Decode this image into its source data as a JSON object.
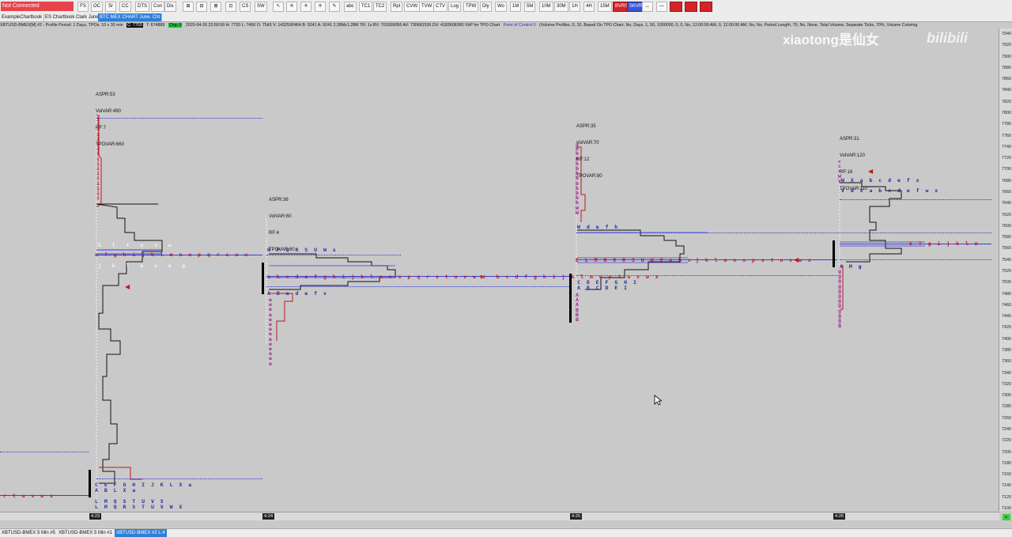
{
  "status": {
    "label": "Not Connected",
    "color": "#e8434b"
  },
  "toolbar": [
    {
      "label": "FS"
    },
    {
      "label": "OC"
    },
    {
      "label": "Sr"
    },
    {
      "label": "CC"
    },
    {
      "label": "DTS"
    },
    {
      "label": "Con"
    },
    {
      "label": "Dis"
    },
    {
      "label": "⊞"
    },
    {
      "label": "⊟"
    },
    {
      "label": "⊠"
    },
    {
      "label": "⊡"
    },
    {
      "label": "CS"
    },
    {
      "label": "SW"
    },
    {
      "label": "↖"
    },
    {
      "label": "✛"
    },
    {
      "label": "✛"
    },
    {
      "label": "✛"
    },
    {
      "label": "✎"
    },
    {
      "label": "abc"
    },
    {
      "label": "TC1"
    },
    {
      "label": "TC2"
    },
    {
      "label": "Rpl"
    },
    {
      "label": "CVW"
    },
    {
      "label": "TVW"
    },
    {
      "label": "CTV"
    },
    {
      "label": "Log"
    },
    {
      "label": "TPW"
    },
    {
      "label": "Dly"
    },
    {
      "label": "Wo"
    },
    {
      "label": "1M"
    },
    {
      "label": "5M"
    },
    {
      "label": "10M"
    },
    {
      "label": "30M"
    },
    {
      "label": "1H"
    },
    {
      "label": "4H"
    },
    {
      "label": "15M"
    },
    {
      "label": "BVRS",
      "style": "red"
    },
    {
      "label": "SKVR",
      "style": "blue"
    },
    {
      "label": "↔"
    },
    {
      "label": "—"
    },
    {
      "label": "",
      "style": "red"
    },
    {
      "label": "",
      "style": "red"
    },
    {
      "label": "",
      "style": "red"
    }
  ],
  "tabs": [
    {
      "label": "ExampleChartbook",
      "active": false
    },
    {
      "label": "ES Chartbook Clark June",
      "active": false
    },
    {
      "label": "BTC MEX CHART June. Cht",
      "active": true
    }
  ],
  "info_line": {
    "symbol": "XBTUSD-BMEX[M]  #2 - Profile Period: 1 Days, TPOs: 10 x 30 min",
    "c_value": "C: 7703",
    "t_value": "T: 674889",
    "chg_value": "Chg: 0",
    "stats": "2020-04-26 23:59:59  H: 7720  L: 7450  O: 7543  V: 1432590464  B: 9241  A: 9241  2.28Mx1.28M  TR: 1s  BV: 701909056  AV: 730681536  DV: 4183608360  VbP for TPO Chart",
    "poc": "Point of Control 0",
    "vp": "(Volume Profiles, 0, 10, Based On TPO Chart, No, Days, 1, 50, 1000000, 0, 0, No, 12:00:00 AM, 0, 12:00:00 AM, No, No, Period Length, 70, No, None, Total Volume, Separate Ticks, 70%, Volume Coloring"
  },
  "price_axis": [
    "7940",
    "7920",
    "7900",
    "7880",
    "7860",
    "7840",
    "7820",
    "7800",
    "7780",
    "7760",
    "7740",
    "7720",
    "7700",
    "7680",
    "7660",
    "7640",
    "7620",
    "7600",
    "7580",
    "7560",
    "7540",
    "7520",
    "7500",
    "7480",
    "7460",
    "7440",
    "7420",
    "7400",
    "7380",
    "7360",
    "7340",
    "7320",
    "7300",
    "7280",
    "7260",
    "7240",
    "7220",
    "7200",
    "7180",
    "7160",
    "7140",
    "7120",
    "7100"
  ],
  "dates": [
    "4-23",
    "4-24",
    "4-25",
    "4-26"
  ],
  "profiles": [
    {
      "aspr": "ASPR:53",
      "volvar": "VolVAR:490",
      "rf": "RF:7",
      "tpovar": "TPOVAR:660"
    },
    {
      "aspr": "ASPR:36",
      "volvar": "VolVAR:60",
      "rf": "RF:4",
      "tpovar": "TPOVAR:60"
    },
    {
      "aspr": "ASPR:35",
      "volvar": "VolVAR:70",
      "rf": "RF:12",
      "tpovar": "TPOVAR:80"
    },
    {
      "aspr": "ASPR:31",
      "volvar": "VolVAR:120",
      "rf": "RF:16",
      "tpovar": "TPOVAR:110"
    }
  ],
  "tpo_rows": {
    "p1_poc": "e f g h i j k l m n o p q r s u w",
    "p1_a": "t u v w",
    "p1_b": "k  l  t  u  v  w",
    "p1_c": "j  k  l  m  n  o  p",
    "p1_bot1": "C E F G H I J K L X a",
    "p1_bot2": "A B L X a",
    "p1_bot3": "L M Q S T U V X",
    "p1_bot4": "L M Q R S T U V W X",
    "p0_left": "r t u v w x",
    "p2_top": "H P Q R S U W s",
    "p2_poc": "a b c d e f g h i j k l m n o p q r s t u v w x  b c d f g h i j k l m o p t u v w x",
    "p2_a": "A D a d e f v",
    "p3_top": "W d e f h",
    "p3_poc": "E L M N O R S U W X a b c",
    "p3_right": "j k l m n o p s t u v w x",
    "p3_a": "C D E F G H I",
    "p3_b": "A B C D E I",
    "p4_top": "W X a b c d e f x",
    "p4_top2": "V W X a b c d e f w x",
    "p4_poc": "S T g i j k l m",
    "p4_amg": "A M g"
  },
  "watermark": "xiaotong是仙女",
  "watermark2": "bilibili",
  "status_tabs": [
    {
      "label": "XBTUSD-BMEX  5 Min  #5",
      "active": false
    },
    {
      "label": "XBTUSD-BMEX  5 Min  #1",
      "active": false
    },
    {
      "label": "XBTUSD-BMEX  #2  L:4",
      "active": true
    }
  ],
  "colors": {
    "background": "#c9c9c9",
    "tpo_red": "#c01820",
    "tpo_blue": "#2a2aa8",
    "poc_line": "#2f2fd8"
  }
}
